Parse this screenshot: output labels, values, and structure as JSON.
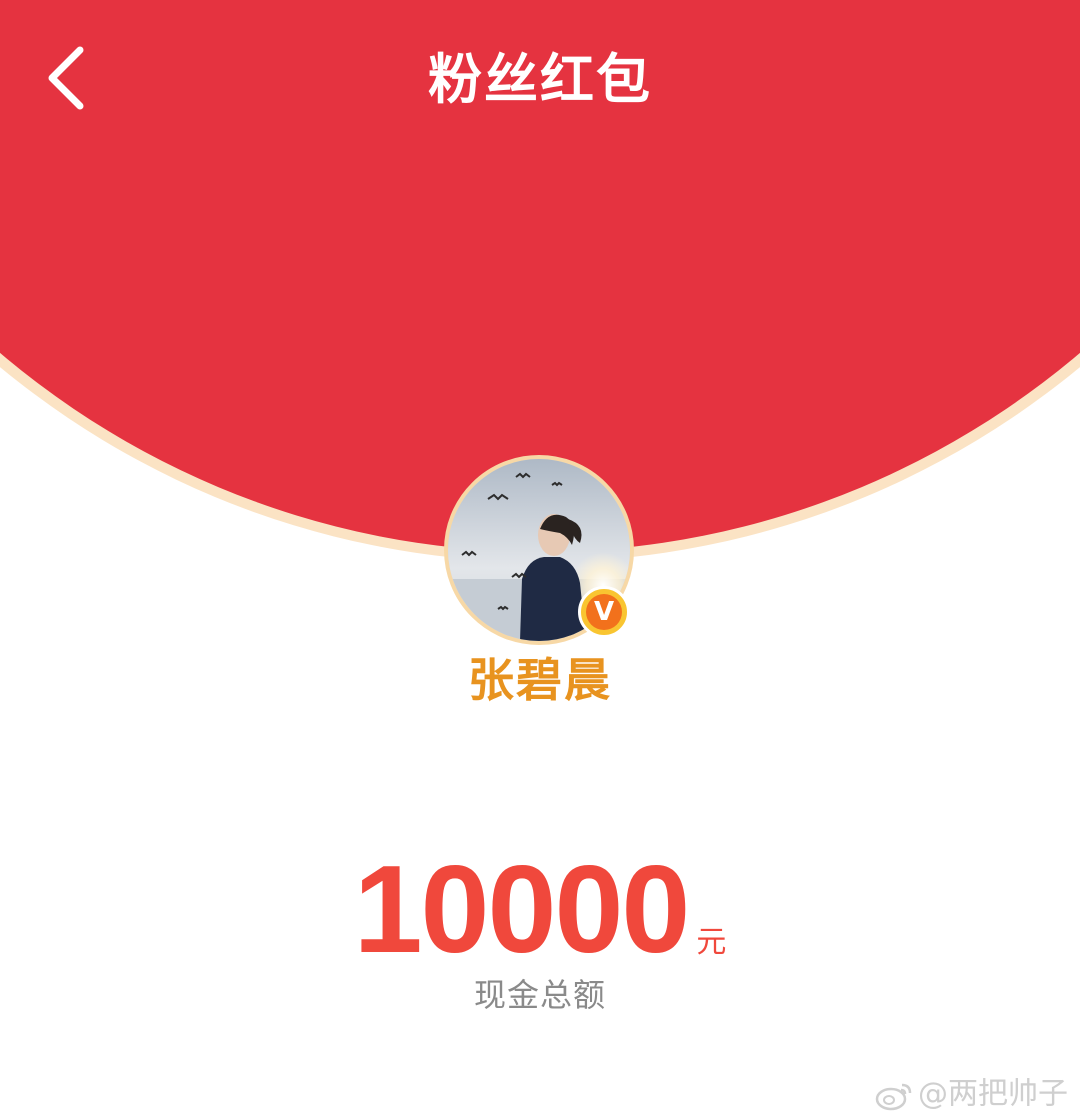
{
  "header": {
    "title": "粉丝红包",
    "back_icon": "chevron-left-icon"
  },
  "sender": {
    "name": "张碧晨",
    "verified_badge_icon": "v-badge-icon",
    "verified_badge_label": "V"
  },
  "red_packet": {
    "amount": "10000",
    "unit": "元",
    "caption": "现金总额"
  },
  "watermark": {
    "icon": "weibo-icon",
    "text": "@两把帅子"
  },
  "colors": {
    "envelope_red": "#e53340",
    "envelope_rim": "#fbe3c4",
    "amount_red": "#f0483c",
    "name_gold": "#e8931f",
    "badge_yellow": "#f9c531",
    "badge_orange": "#f2711c"
  }
}
